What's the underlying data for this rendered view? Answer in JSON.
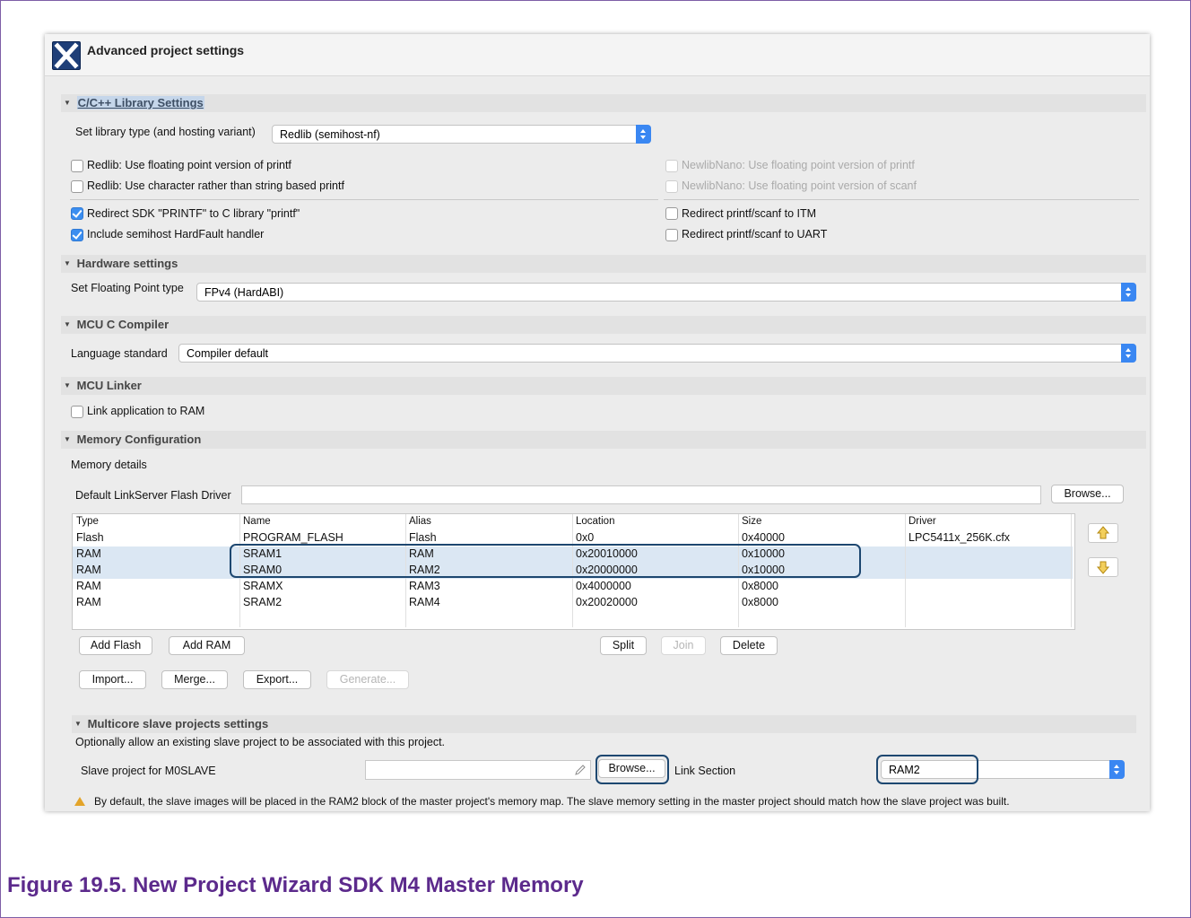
{
  "dialog": {
    "title": "Advanced project settings"
  },
  "library": {
    "section": "C/C++ Library Settings",
    "type_label": "Set library type (and hosting variant)",
    "type_value": "Redlib (semihost-nf)",
    "options": {
      "redlib_float_printf": "Redlib: Use floating point version of printf",
      "redlib_char_printf": "Redlib: Use character rather than string based printf",
      "newlibnano_float_printf": "NewlibNano: Use floating point version of printf",
      "newlibnano_float_scanf": "NewlibNano: Use floating point version of scanf",
      "redirect_sdk_printf": "Redirect SDK \"PRINTF\" to C library \"printf\"",
      "include_hardfault": "Include semihost HardFault handler",
      "redirect_itm": "Redirect printf/scanf to ITM",
      "redirect_uart": "Redirect printf/scanf to UART"
    },
    "checked": {
      "redirect_sdk_printf": true,
      "include_hardfault": true
    }
  },
  "hardware": {
    "section": "Hardware settings",
    "fp_label": "Set Floating Point type",
    "fp_value": "FPv4 (HardABI)"
  },
  "compiler": {
    "section": "MCU C Compiler",
    "lang_label": "Language standard",
    "lang_value": "Compiler default"
  },
  "linker": {
    "section": "MCU Linker",
    "link_ram": "Link application to RAM"
  },
  "memory": {
    "section": "Memory Configuration",
    "details_label": "Memory details",
    "flash_driver_label": "Default LinkServer Flash Driver",
    "browse": "Browse...",
    "columns": [
      "Type",
      "Name",
      "Alias",
      "Location",
      "Size",
      "Driver"
    ],
    "rows": [
      [
        "Flash",
        "PROGRAM_FLASH",
        "Flash",
        "0x0",
        "0x40000",
        "LPC5411x_256K.cfx"
      ],
      [
        "RAM",
        "SRAM1",
        "RAM",
        "0x20010000",
        "0x10000",
        ""
      ],
      [
        "RAM",
        "SRAM0",
        "RAM2",
        "0x20000000",
        "0x10000",
        ""
      ],
      [
        "RAM",
        "SRAMX",
        "RAM3",
        "0x4000000",
        "0x8000",
        ""
      ],
      [
        "RAM",
        "SRAM2",
        "RAM4",
        "0x20020000",
        "0x8000",
        ""
      ]
    ],
    "buttons": {
      "add_flash": "Add Flash",
      "add_ram": "Add RAM",
      "split": "Split",
      "join": "Join",
      "delete": "Delete",
      "import": "Import...",
      "merge": "Merge...",
      "export": "Export...",
      "generate": "Generate..."
    }
  },
  "multicore": {
    "section": "Multicore slave projects settings",
    "description": "Optionally allow an existing slave project to be associated with this project.",
    "slave_label": "Slave project for M0SLAVE",
    "browse": "Browse...",
    "link_section_label": "Link Section",
    "link_section_value": "RAM2",
    "note": "By default, the slave images will be placed in the RAM2 block of the master project's memory map. The slave memory setting in the master project should match how the slave project was built."
  },
  "caption": "Figure 19.5. New Project Wizard SDK M4 Master Memory"
}
